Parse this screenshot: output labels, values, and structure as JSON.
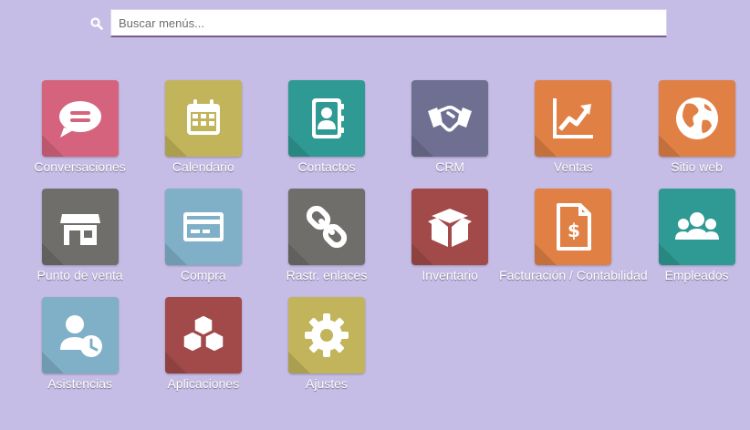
{
  "search": {
    "placeholder": "Buscar menús..."
  },
  "apps": [
    {
      "label": "Conversaciones",
      "icon": "chat-bubble-icon",
      "color": "#d5637e"
    },
    {
      "label": "Calendario",
      "icon": "calendar-icon",
      "color": "#c2b45b"
    },
    {
      "label": "Contactos",
      "icon": "address-book-icon",
      "color": "#2f9a94"
    },
    {
      "label": "CRM",
      "icon": "handshake-icon",
      "color": "#6f6f92"
    },
    {
      "label": "Ventas",
      "icon": "chart-line-icon",
      "color": "#e08045"
    },
    {
      "label": "Sitio web",
      "icon": "globe-icon",
      "color": "#e08045"
    },
    {
      "label": "Punto de venta",
      "icon": "store-icon",
      "color": "#6f6e6b"
    },
    {
      "label": "Compra",
      "icon": "credit-card-icon",
      "color": "#7fb0c8"
    },
    {
      "label": "Rastr. enlaces",
      "icon": "link-icon",
      "color": "#6f6e6b"
    },
    {
      "label": "Inventario",
      "icon": "box-icon",
      "color": "#a24a4a"
    },
    {
      "label": "Facturación / Contabilidad",
      "icon": "invoice-dollar-icon",
      "color": "#e08045"
    },
    {
      "label": "Empleados",
      "icon": "users-icon",
      "color": "#2f9a94"
    },
    {
      "label": "Asistencias",
      "icon": "user-clock-icon",
      "color": "#7fb0c8"
    },
    {
      "label": "Aplicaciones",
      "icon": "cubes-icon",
      "color": "#a24a4a"
    },
    {
      "label": "Ajustes",
      "icon": "gear-icon",
      "color": "#c2b45b"
    }
  ]
}
